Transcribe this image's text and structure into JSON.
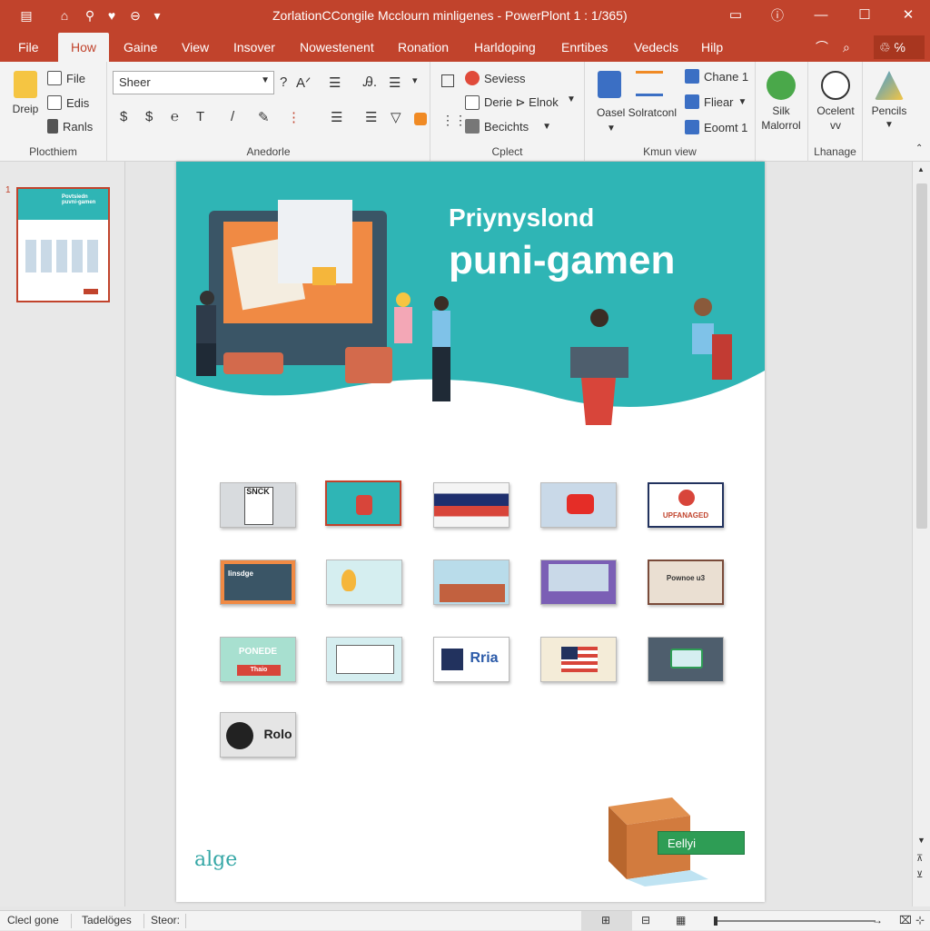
{
  "window": {
    "title": "ZorlationCCongile Mcclourn minligenes - PowerPlont 1 : 1/365)",
    "controls": {
      "restore_label": "▭",
      "minimize_label": "—",
      "maximize_label": "☐",
      "close_label": "✕"
    }
  },
  "quick_access": {
    "save_label": "▤",
    "home_label": "⌂",
    "pin_label": "⚲",
    "pin2_label": "♥",
    "stop_label": "⊖",
    "more_label": "▾"
  },
  "menu": {
    "tabs": [
      "File",
      "How",
      "Gaine",
      "View",
      "Insover",
      "Nowestenent",
      "Ronation",
      "Harldoping",
      "Enrtibes",
      "Vedecls",
      "Hilp"
    ],
    "active_tab": "How",
    "share_label": "℅"
  },
  "ribbon": {
    "groups": {
      "plocthiem": {
        "label": "Plocthiem",
        "drop_label": "Dreip",
        "items": [
          "File",
          "Edis",
          "Ranls"
        ]
      },
      "anedorle": {
        "label": "Anedorle",
        "font_name": "Sheer",
        "row1_tools": [
          "?",
          "Aᐟ",
          "☰",
          "Ꭿ.",
          "☰",
          "▾"
        ],
        "row2_tools": [
          "$",
          "$",
          "℮",
          "T",
          "/",
          "✎",
          "⋮",
          "☰",
          "☰",
          "▽"
        ]
      },
      "cplect": {
        "label": "Cplect",
        "items": [
          "Seviess",
          "Derie ⊳ Elnok",
          "Becichts"
        ]
      },
      "kmun_view": {
        "label": "Kmun view",
        "big_label": "Oasel Solratconl",
        "items": [
          "Chane 1",
          "Fliear",
          "Eoomt 1"
        ]
      },
      "silk": {
        "label_line1": "Silk",
        "label_line2": "Malorrol"
      },
      "oceleint": {
        "label_line1": "Ocelent",
        "label_line2": "vv",
        "group_label": "Lhanage"
      },
      "pencils": {
        "label": "Pencils"
      }
    }
  },
  "slide": {
    "title_line1": "Priynyslond",
    "title_line2": "puni-gamen",
    "thumb_number": "1",
    "thumb_title": "Povtsiedn\npuvni-gamen",
    "tiles": [
      {
        "label": "SNCK"
      },
      {
        "label": ""
      },
      {
        "label": ""
      },
      {
        "label": ""
      },
      {
        "label": "UPFANAGED"
      },
      {
        "label": "Iinsdge"
      },
      {
        "label": ""
      },
      {
        "label": ""
      },
      {
        "label": ""
      },
      {
        "label": "Pownoe u3"
      },
      {
        "label": "PONEDE"
      },
      {
        "label": ""
      },
      {
        "label": "Rria"
      },
      {
        "label": ""
      },
      {
        "label": ""
      },
      {
        "label": "Rolo"
      }
    ],
    "tile_sub": "Thaio",
    "logo_text": "alge",
    "badge_text": "Eellyi"
  },
  "status": {
    "left": "Clecl gone",
    "mid": "Tadelöges",
    "right": "Steor:"
  },
  "colors": {
    "accent": "#c1432c",
    "teal": "#2fb5b5",
    "green": "#2e9d55"
  }
}
